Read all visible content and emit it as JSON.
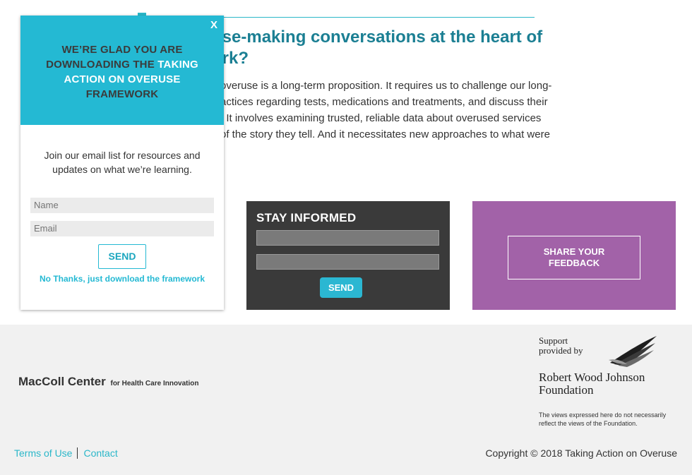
{
  "article": {
    "title": "nse-making conversations at the heart of\nork?",
    "body": "overuse is a long-term proposition. It requires us to challenge our long-\nactices regarding tests, medications and treatments, and discuss their\n. It involves examining trusted, reliable data about overused services\nof the story they tell. And it necessitates new approaches to what were"
  },
  "stay_informed": {
    "title": "STAY INFORMED",
    "send_label": "SEND"
  },
  "feedback": {
    "button_label": "SHARE YOUR FEEDBACK"
  },
  "popup": {
    "close_label": "X",
    "heading_part1": "WE’RE GLAD YOU ARE DOWNLOADING THE ",
    "heading_highlight": "TAKING ACTION ON OVERUSE",
    "heading_part2": " FRAMEWORK",
    "description": "Join our email list for resources and updates on what we’re learning.",
    "name_placeholder": "Name",
    "email_placeholder": "Email",
    "send_label": "SEND",
    "skip_label": "No Thanks, just download the framework"
  },
  "footer": {
    "maccoll_name": "MacColl Center",
    "maccoll_sub": "for Health Care Innovation",
    "support_text": "Support\nprovided by",
    "rwjf_name": "Robert Wood Johnson Foundation",
    "disclaimer": "The views expressed here do not necessarily reflect the views of the Foundation.",
    "links": [
      "Terms of Use",
      "Contact"
    ],
    "copyright": "Copyright © 2018 Taking Action on Overuse"
  },
  "colors": {
    "accent_teal": "#24b9d3",
    "title_teal": "#1b7f93",
    "feedback_purple": "#a262a8",
    "stay_dark": "#3a3a3a",
    "footer_bg": "#f1f1f1"
  }
}
